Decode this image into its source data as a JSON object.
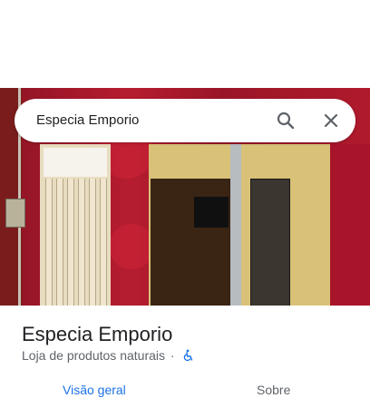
{
  "search": {
    "value": "Especia Emporio"
  },
  "place": {
    "name": "Especia Emporio",
    "category": "Loja de produtos naturais",
    "separator": "·",
    "accessibility_icon": "wheelchair-icon"
  },
  "tabs": [
    {
      "label": "Visão geral",
      "active": true
    },
    {
      "label": "Sobre",
      "active": false
    }
  ],
  "colors": {
    "accent": "#1a73e8",
    "text_primary": "#202124",
    "text_secondary": "#5f6368",
    "storefront_wall": "#a3172a"
  }
}
